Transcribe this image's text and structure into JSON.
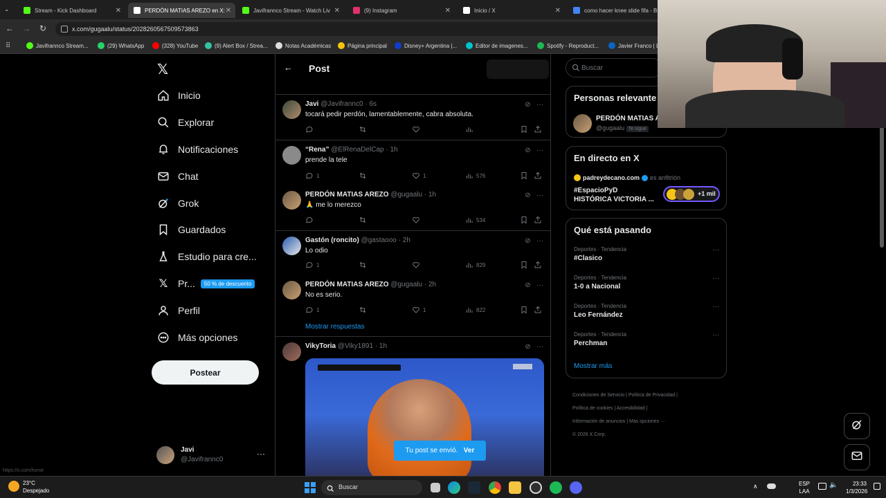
{
  "browser": {
    "tabs": [
      {
        "label": "Stream - Kick Dashboard",
        "color": "#53fc18",
        "active": false
      },
      {
        "label": "PERDÓN MATIAS AREZO en X:",
        "color": "#ffffff",
        "active": true
      },
      {
        "label": "Javifrannco Stream - Watch Liv",
        "color": "#53fc18",
        "active": false
      },
      {
        "label": "(9) Instagram",
        "color": "#e1306c",
        "active": false
      },
      {
        "label": "Inicio / X",
        "color": "#ffffff",
        "active": false
      },
      {
        "label": "como hacer knee slide fifa - Bu",
        "color": "#4285f4",
        "active": false
      }
    ],
    "url": "x.com/gugaalu/status/2028260567509573863",
    "bookmarks": [
      {
        "label": "Javifrannco Stream...",
        "color": "#53fc18"
      },
      {
        "label": "(29) WhatsApp",
        "color": "#25d366"
      },
      {
        "label": "(328) YouTube",
        "color": "#ff0000"
      },
      {
        "label": "(9) Alert Box / Strea...",
        "color": "#31c3a2"
      },
      {
        "label": "Notas Académicas",
        "color": "#dddddd"
      },
      {
        "label": "Página principal",
        "color": "#f4c20d"
      },
      {
        "label": "Disney+ Argentina |...",
        "color": "#113ccf"
      },
      {
        "label": "Editor de imagenes...",
        "color": "#00c4cc"
      },
      {
        "label": "Spotify - Reproduct...",
        "color": "#1db954"
      },
      {
        "label": "Javier Franco | Li",
        "color": "#0a66c2"
      }
    ]
  },
  "nav": {
    "items": [
      {
        "label": "Inicio",
        "icon": "home-icon"
      },
      {
        "label": "Explorar",
        "icon": "search-icon"
      },
      {
        "label": "Notificaciones",
        "icon": "bell-icon"
      },
      {
        "label": "Chat",
        "icon": "mail-icon"
      },
      {
        "label": "Grok",
        "icon": "grok-icon"
      },
      {
        "label": "Guardados",
        "icon": "bookmark-icon"
      },
      {
        "label": "Estudio para cre...",
        "icon": "flask-icon"
      },
      {
        "label": "Pr...",
        "icon": "x-logo-icon"
      },
      {
        "label": "Perfil",
        "icon": "person-icon"
      },
      {
        "label": "Más opciones",
        "icon": "more-circle-icon"
      }
    ],
    "discount": "50 % de descuento",
    "post_button": "Postear",
    "account": {
      "name": "Javi",
      "handle": "@Javifrannc0"
    }
  },
  "header": {
    "title": "Post"
  },
  "tweets": [
    {
      "name": "Javi",
      "handle": "@Javifrannc0",
      "time": "6s",
      "text": "tocará pedir perdón, lamentablemente, cabra absoluta.",
      "replies": "",
      "likes": "",
      "views": ""
    },
    {
      "name": "“Rena”",
      "handle": "@ElRenaDelCap",
      "time": "1h",
      "text": "prende la tele",
      "replies": "1",
      "likes": "1",
      "views": "576"
    },
    {
      "name": "PERDÓN MATIAS AREZO",
      "handle": "@gugaalu",
      "time": "1h",
      "text": "🙏 me lo merezco",
      "replies": "",
      "likes": "",
      "views": "534"
    },
    {
      "name": "Gastón (roncito)",
      "handle": "@gastaooo",
      "time": "2h",
      "text": "Lo odio",
      "replies": "1",
      "likes": "",
      "views": "829"
    },
    {
      "name": "PERDÓN MATIAS AREZO",
      "handle": "@gugaalu",
      "time": "2h",
      "text": "No es serio.",
      "replies": "1",
      "likes": "1",
      "views": "822"
    },
    {
      "name": "VikyToria",
      "handle": "@Viky1891",
      "time": "1h",
      "text": "",
      "replies": "",
      "likes": "",
      "views": ""
    }
  ],
  "show_replies": "Mostrar respuestas",
  "toast": {
    "text": "Tu post se envió.",
    "action": "Ver"
  },
  "search": {
    "placeholder": "Buscar"
  },
  "relevant": {
    "title": "Personas relevante",
    "name": "PERDÓN MATIAS A",
    "handle": "@gugaalu",
    "follows_you": "Te sigue"
  },
  "live": {
    "title": "En directo en X",
    "host": "padreydecano.com",
    "host_role": "es anfitrión",
    "space_title_1": "#EspacioPyD",
    "space_title_2": "HISTÓRICA VICTORIA ...",
    "listeners": "+1 mil"
  },
  "trending": {
    "title": "Qué está pasando",
    "items": [
      {
        "category": "Deportes · Tendencia",
        "name": "#Clasico"
      },
      {
        "category": "Deportes · Tendencia",
        "name": "1-0 a Nacional"
      },
      {
        "category": "Deportes · Tendencia",
        "name": "Leo Fernández"
      },
      {
        "category": "Deportes · Tendencia",
        "name": "Perchman"
      }
    ],
    "show_more": "Mostrar más"
  },
  "footer": {
    "links": [
      "Condiciones de Servicio",
      "Política de Privacidad",
      "Política de cookies",
      "Accesibilidad",
      "Información de anuncios",
      "Más opciones ···"
    ],
    "copyright": "© 2026 X Corp."
  },
  "status_url": "https://x.com/home",
  "taskbar": {
    "weather_temp": "23°C",
    "weather_desc": "Despejado",
    "search": "Buscar",
    "lang_1": "ESP",
    "lang_2": "LAA",
    "time": "23:33",
    "date": "1/3/2026"
  }
}
